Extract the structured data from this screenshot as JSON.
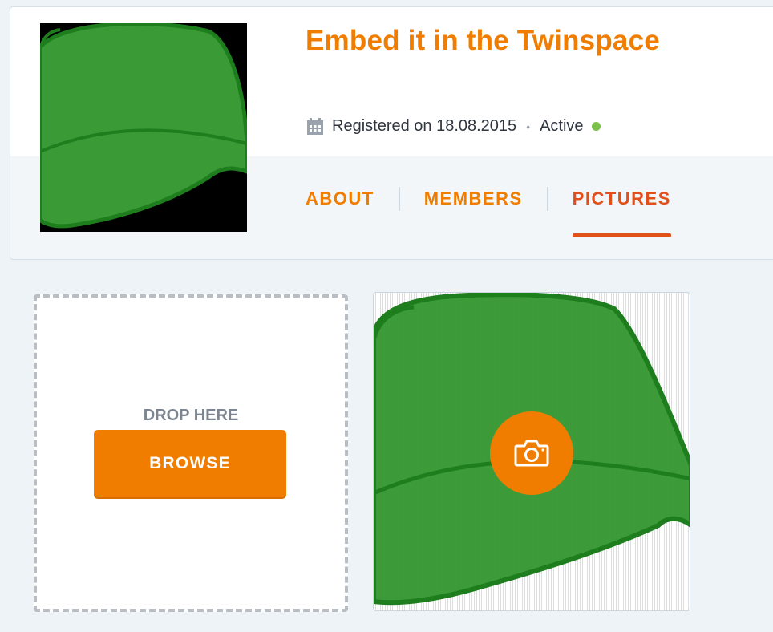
{
  "header": {
    "title": "Embed it in the Twinspace",
    "registered_text": "Registered on 18.08.2015",
    "separator": "•",
    "status_text": "Active",
    "calendar_icon": "calendar-icon",
    "status_color": "#7cc04b"
  },
  "tabs": [
    {
      "label": "ABOUT",
      "active": false
    },
    {
      "label": "MEMBERS",
      "active": false
    },
    {
      "label": "PICTURES",
      "active": true
    }
  ],
  "upload": {
    "drop_label": "DROP HERE",
    "browse_label": "BROWSE"
  },
  "picture": {
    "overlay_icon": "camera-icon"
  },
  "colors": {
    "accent": "#f07d00",
    "active_tab": "#e1501b",
    "leaf_green": "#3a9a36"
  }
}
